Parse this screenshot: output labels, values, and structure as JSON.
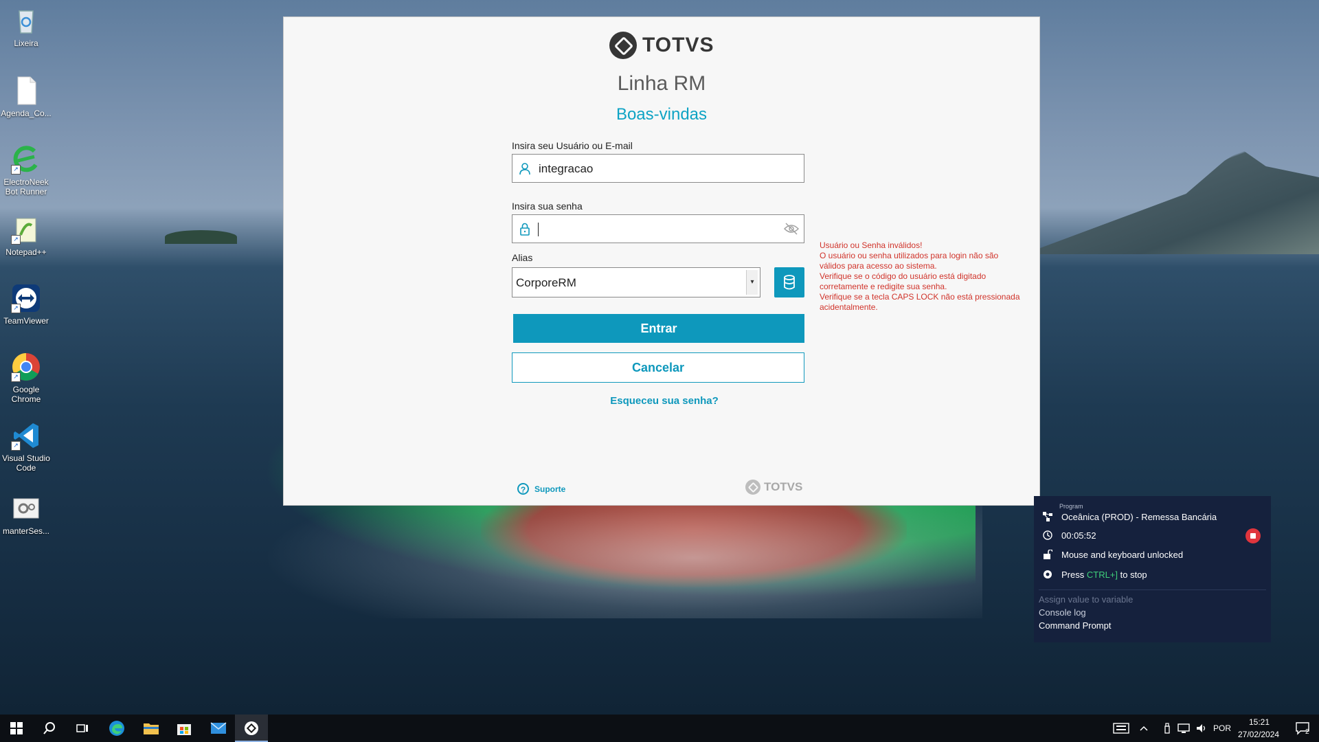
{
  "desktop": {
    "icons": [
      {
        "label": "Lixeira",
        "icon": "recycle-bin-icon"
      },
      {
        "label": "Agenda_Co...",
        "icon": "file-icon"
      },
      {
        "label": "ElectroNeek Bot Runner",
        "icon": "electroneek-icon"
      },
      {
        "label": "Notepad++",
        "icon": "notepadpp-icon"
      },
      {
        "label": "TeamViewer",
        "icon": "teamviewer-icon"
      },
      {
        "label": "Google Chrome",
        "icon": "chrome-icon"
      },
      {
        "label": "Visual Studio Code",
        "icon": "vscode-icon"
      },
      {
        "label": "manterSes...",
        "icon": "settings-file-icon"
      }
    ]
  },
  "login": {
    "brand": "TOTVS",
    "product": "Linha RM",
    "welcome": "Boas-vindas",
    "user_label": "Insira seu Usuário ou E-mail",
    "user_value": "integracao",
    "password_label": "Insira sua senha",
    "password_value": "",
    "alias_label": "Alias",
    "alias_value": "CorporeRM",
    "enter_button": "Entrar",
    "cancel_button": "Cancelar",
    "forgot_link": "Esqueceu sua senha?",
    "support_link": "Suporte",
    "footer_brand": "TOTVS",
    "error_lines": [
      "Usuário ou Senha inválidos!",
      "O usuário ou senha utilizados para login não são válidos para acesso ao sistema.",
      "Verifique se o código do usuário está digitado corretamente e redigite sua senha.",
      "Verifique se a tecla CAPS LOCK não está pressionada acidentalmente."
    ],
    "accent_color": "#0e98bc",
    "error_color": "#d0332a"
  },
  "bot": {
    "program_caption": "Program",
    "program_name": "Oceânica (PROD) - Remessa Bancária",
    "elapsed": "00:05:52",
    "lock_status": "Mouse and keyboard unlocked",
    "stop_hint_prefix": "Press",
    "stop_hint_key": "CTRL+]",
    "stop_hint_suffix": "to stop",
    "logs": [
      "Assign value to variable",
      "Console log",
      "Command Prompt"
    ]
  },
  "taskbar": {
    "apps": [
      "windows-start-icon",
      "search-icon",
      "task-view-icon",
      "edge-icon",
      "file-explorer-icon",
      "store-icon",
      "mail-icon",
      "totvs-icon"
    ],
    "language": "POR",
    "time": "15:21",
    "date": "27/02/2024",
    "notifications": "2"
  }
}
